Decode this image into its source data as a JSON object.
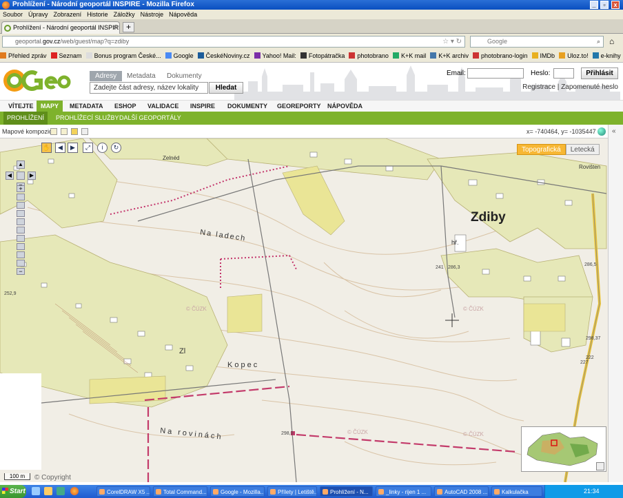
{
  "window": {
    "title": "Prohlížení - Národní geoportál INSPIRE - Mozilla Firefox"
  },
  "menubar": [
    "Soubor",
    "Úpravy",
    "Zobrazení",
    "Historie",
    "Záložky",
    "Nástroje",
    "Nápověda"
  ],
  "tab": {
    "title": "Prohlížení - Národní geoportál INSPIRE"
  },
  "url": {
    "domain": "geoportal.gov.cz",
    "prefix": "geoportal.",
    "bold": "gov.cz",
    "path": "/web/guest/map?q=zdiby"
  },
  "search_engine": "Google",
  "bookmarks": [
    "Přehled zpráv",
    "Seznam",
    "Bonus program České...",
    "Google",
    "ČeskéNoviny.cz",
    "Yahoo! Mail:",
    "Fotopátračka",
    "photobrano",
    "K+K mail",
    "K+K archiv",
    "photobrano-login",
    "IMDb",
    "Uloz.to!",
    "e-knihy"
  ],
  "bookmark_icons": [
    "#e07b1e",
    "#d22",
    "#ddd",
    "#4a8af4",
    "#1b5c9a",
    "#7b2ea8",
    "#333",
    "#c33",
    "#2a6",
    "#47a",
    "#c33",
    "#e8b020",
    "#e8a020",
    "#27a"
  ],
  "header": {
    "search_tabs": [
      "Adresy",
      "Metadata",
      "Dokumenty"
    ],
    "search_placeholder": "Zadejte část adresy, název lokality",
    "search_button": "Hledat",
    "email_label": "Email:",
    "password_label": "Heslo:",
    "login_button": "Přihlásit",
    "register_link": "Registrace",
    "separator": "|",
    "forgot_link": "Zapomenuté heslo"
  },
  "mainnav": [
    "VÍTEJTE",
    "MAPY",
    "METADATA",
    "ESHOP",
    "VALIDACE",
    "INSPIRE",
    "DOKUMENTY",
    "GEOREPORTY",
    "NÁPOVĚDA"
  ],
  "subnav": [
    "PROHLÍŽENÍ",
    "PROHLÍŽECÍ SLUŽBY",
    "DALŠÍ GEOPORTÁLY"
  ],
  "map": {
    "composition_label": "Mapové kompozice:",
    "coords": "x= -740464, y= -1035447",
    "layers": {
      "active": "Topografická",
      "inactive": "Letecká"
    },
    "scale": "100 m",
    "copyright": "© Copyright",
    "watermark": "© ČÚZK",
    "place_labels": [
      "Zdiby",
      "Na ladech",
      "Na rovinách",
      "Kopec",
      "hř.",
      "Zelnéd",
      "Rovišten",
      "Zl"
    ],
    "spot_heights": [
      "241",
      "252,9",
      "286,5",
      "298,0",
      "286,3",
      "298,37",
      "222",
      "227"
    ]
  },
  "taskbar": {
    "start": "Start",
    "items": [
      "CorelDRAW X5 ...",
      "Total Command...",
      "Google - Mozilla...",
      "Přílety | Letiště...",
      "Prohlížení - N...",
      "_linky - rijen 1 ...",
      "AutoCAD 2008 ...",
      "Kalkulačka"
    ],
    "active_index": 4,
    "clock": "21:34"
  },
  "colors": {
    "accent": "#7eb22c",
    "brand_orange": "#f39c12",
    "title_blue": "#0a4fc0"
  }
}
